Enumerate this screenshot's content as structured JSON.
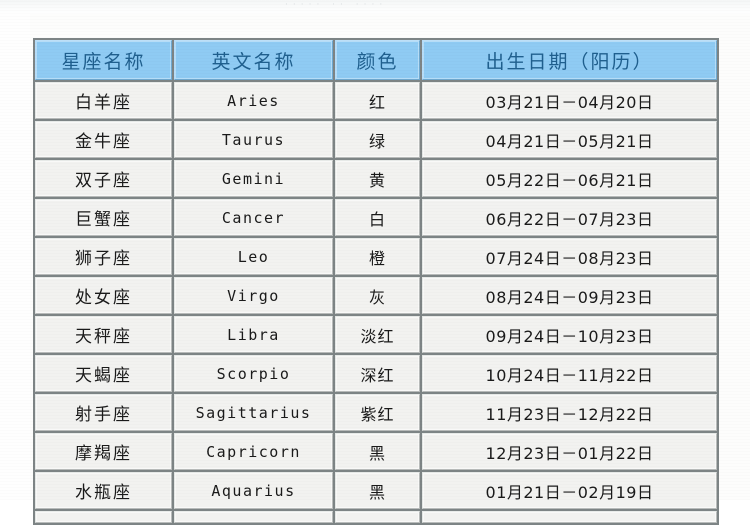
{
  "scan_artifact": {
    "ghost_text": "·····   ··  ····"
  },
  "table": {
    "columns": [
      {
        "key": "name",
        "label": "星座名称"
      },
      {
        "key": "eng",
        "label": "英文名称"
      },
      {
        "key": "color",
        "label": "颜色"
      },
      {
        "key": "date",
        "label": "出生日期（阳历）"
      }
    ],
    "header_bg": "#8fcbf3",
    "header_text_color": "#1f5f8e",
    "cell_bg": "#f2f2f0",
    "rows": [
      {
        "name": "白羊座",
        "eng": "Aries",
        "color": "红",
        "date": "03月21日－04月20日"
      },
      {
        "name": "金牛座",
        "eng": "Taurus",
        "color": "绿",
        "date": "04月21日－05月21日"
      },
      {
        "name": "双子座",
        "eng": "Gemini",
        "color": "黄",
        "date": "05月22日－06月21日"
      },
      {
        "name": "巨蟹座",
        "eng": "Cancer",
        "color": "白",
        "date": "06月22日－07月23日"
      },
      {
        "name": "狮子座",
        "eng": "Leo",
        "color": "橙",
        "date": "07月24日－08月23日"
      },
      {
        "name": "处女座",
        "eng": "Virgo",
        "color": "灰",
        "date": "08月24日－09月23日"
      },
      {
        "name": "天秤座",
        "eng": "Libra",
        "color": "淡红",
        "date": "09月24日－10月23日"
      },
      {
        "name": "天蝎座",
        "eng": "Scorpio",
        "color": "深红",
        "date": "10月24日－11月22日"
      },
      {
        "name": "射手座",
        "eng": "Sagittarius",
        "color": "紫红",
        "date": "11月23日－12月22日"
      },
      {
        "name": "摩羯座",
        "eng": "Capricorn",
        "color": "黑",
        "date": "12月23日－01月22日"
      },
      {
        "name": "水瓶座",
        "eng": "Aquarius",
        "color": "黑",
        "date": "01月21日－02月19日"
      }
    ]
  }
}
